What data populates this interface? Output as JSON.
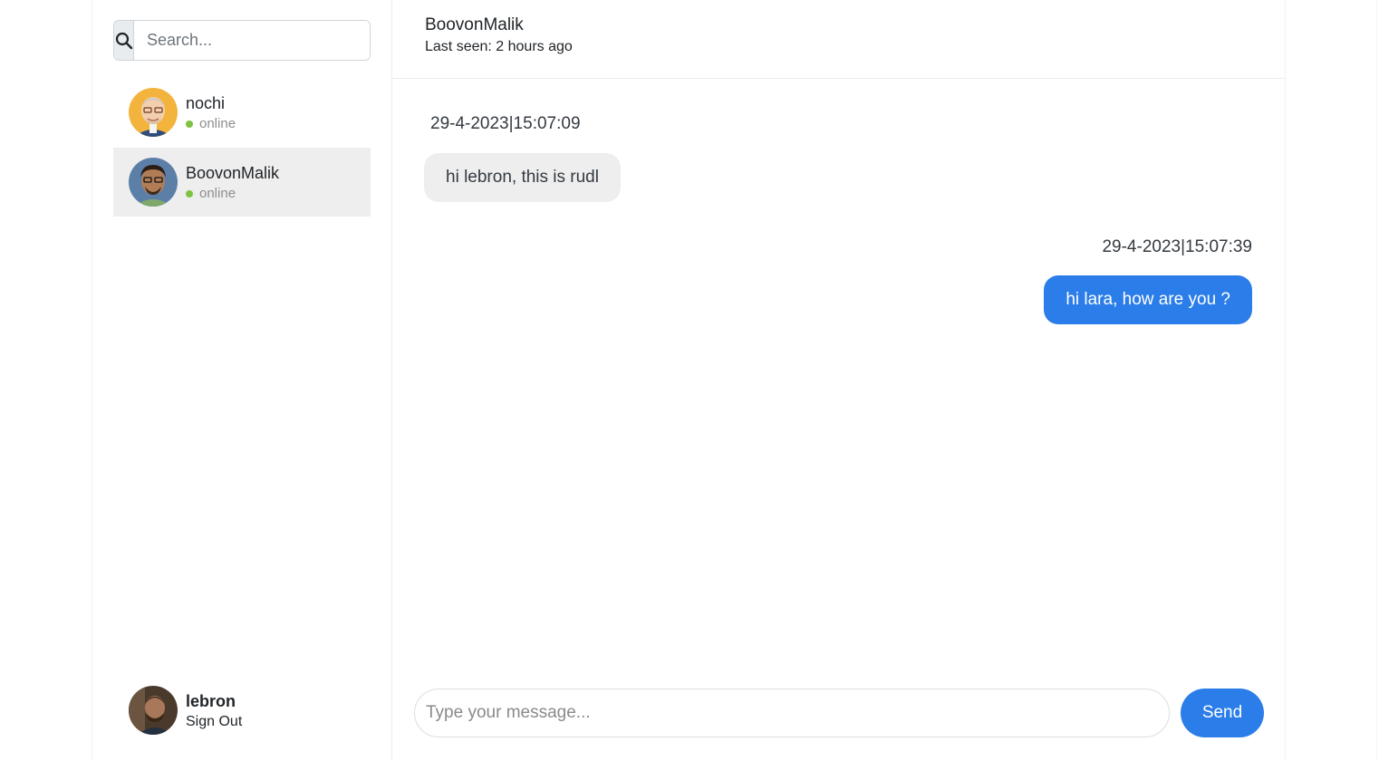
{
  "search": {
    "placeholder": "Search..."
  },
  "contacts": [
    {
      "name": "nochi",
      "status": "online"
    },
    {
      "name": "BoovonMalik",
      "status": "online"
    }
  ],
  "current_user": {
    "name": "lebron",
    "signout_label": "Sign Out"
  },
  "chat": {
    "title": "BoovonMalik",
    "last_seen": "Last seen: 2 hours ago",
    "messages": [
      {
        "time": "29-4-2023|15:07:09",
        "text": "hi lebron, this is rudl",
        "direction": "incoming"
      },
      {
        "time": "29-4-2023|15:07:39",
        "text": "hi lara, how are you ?",
        "direction": "outgoing"
      }
    ]
  },
  "composer": {
    "placeholder": "Type your message...",
    "send_label": "Send"
  },
  "colors": {
    "accent": "#2b7de9",
    "online": "#7cc243",
    "incoming_bubble": "#eeeeee"
  }
}
